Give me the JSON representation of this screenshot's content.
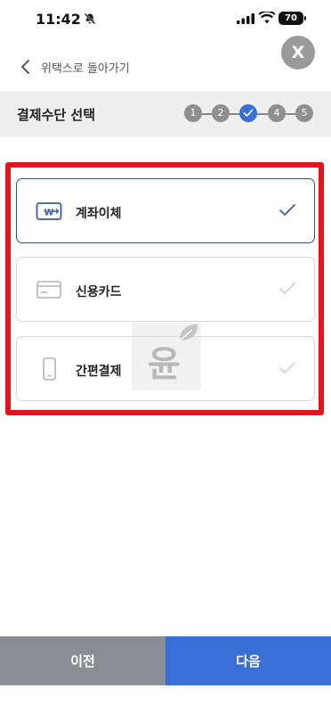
{
  "status_bar": {
    "time": "11:42",
    "battery": "70"
  },
  "close_label": "X",
  "nav": {
    "back_label": "위택스로 돌아가기"
  },
  "section": {
    "title": "결제수단 선택"
  },
  "stepper": {
    "steps": [
      "1",
      "2",
      "",
      "4",
      "5"
    ],
    "current_step": 3
  },
  "payment_options": [
    {
      "label": "계좌이체",
      "icon": "bank-transfer-icon",
      "selected": true
    },
    {
      "label": "신용카드",
      "icon": "credit-card-icon",
      "selected": false
    },
    {
      "label": "간편결제",
      "icon": "mobile-phone-icon",
      "selected": false
    }
  ],
  "watermark": {
    "text": "윤"
  },
  "footer": {
    "prev_label": "이전",
    "next_label": "다음"
  },
  "colors": {
    "accent": "#3a6fd8",
    "highlight": "#e8121b",
    "selected_border": "#3b4f7d",
    "inactive": "#8f8f8f"
  }
}
